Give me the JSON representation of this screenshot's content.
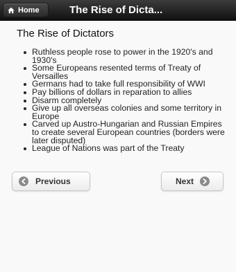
{
  "header": {
    "home_label": "Home",
    "title": "The Rise of Dicta..."
  },
  "content": {
    "heading": "The Rise of Dictators",
    "bullets": [
      "Ruthless people rose to power in the 1920's and 1930's",
      "Some Europeans resented terms of Treaty of Versailles",
      "Germans had to take full responsibility of WWI",
      "Pay billions of dollars in reparation to allies",
      "Disarm completely",
      "Give up all overseas colonies and some territory in Europe",
      "Carved up Austro-Hungarian and Russian Empires to create several European countries (borders were later disputed)",
      "League of Nations was part of the Treaty"
    ]
  },
  "nav": {
    "previous_label": "Previous",
    "next_label": "Next"
  },
  "icons": {
    "home": "home-icon",
    "previous": "arrow-left-circle-icon",
    "next": "arrow-right-circle-icon"
  },
  "colors": {
    "header_bg": "#1a1a1a",
    "page_bg": "#f9f9f9",
    "button_bg": "#f2f2f2",
    "icon_circle": "#8a8a8a"
  }
}
